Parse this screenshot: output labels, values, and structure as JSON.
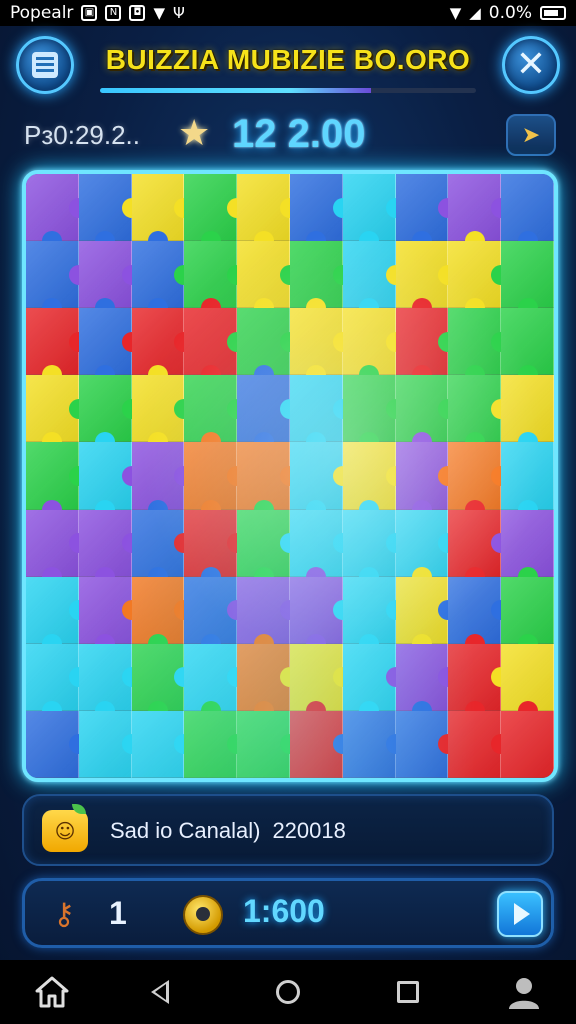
{
  "status_bar": {
    "carrier": "Popealr",
    "battery_text": "0.0%",
    "icons": [
      "image-icon",
      "n-icon",
      "bag-icon",
      "signal-icon",
      "usb-icon",
      "wifi-icon",
      "cell-signal-icon",
      "battery-icon"
    ]
  },
  "header": {
    "title": "BUIZZIA MUBIZIE BO.ORO",
    "progress": 0.72,
    "menu_icon": "menu-icon",
    "close_icon": "close-icon"
  },
  "score_row": {
    "label": "Pз0:29.2..",
    "value": "12 2.00",
    "star_icon": "star-icon",
    "hint_icon": "hint-icon"
  },
  "board": {
    "rows": 9,
    "cols": 10,
    "colors": {
      "R": "#e8262a",
      "B": "#2f6fe0",
      "G": "#2bd24a",
      "Y": "#f4e025",
      "C": "#29d4f2",
      "P": "#8c52e0",
      "O": "#f5761e",
      "L": "#7fb8ff"
    },
    "pieces": [
      [
        "P",
        "B",
        "Y",
        "G",
        "Y",
        "B",
        "C",
        "B",
        "P",
        "B"
      ],
      [
        "B",
        "P",
        "B",
        "G",
        "Y",
        "G",
        "C",
        "Y",
        "Y",
        "G"
      ],
      [
        "R",
        "B",
        "R",
        "R",
        "G",
        "Y",
        "Y",
        "R",
        "G",
        "G"
      ],
      [
        "Y",
        "G",
        "Y",
        "G",
        "B",
        "C",
        "G",
        "G",
        "G",
        "Y"
      ],
      [
        "G",
        "C",
        "P",
        "O",
        "O",
        "C",
        "Y",
        "P",
        "O",
        "C"
      ],
      [
        "P",
        "P",
        "B",
        "R",
        "G",
        "C",
        "C",
        "C",
        "R",
        "P"
      ],
      [
        "C",
        "P",
        "O",
        "B",
        "P",
        "P",
        "C",
        "Y",
        "B",
        "G"
      ],
      [
        "C",
        "C",
        "G",
        "C",
        "O",
        "Y",
        "C",
        "P",
        "R",
        "Y"
      ],
      [
        "B",
        "C",
        "C",
        "G",
        "G",
        "R",
        "B",
        "B",
        "R",
        "R"
      ]
    ]
  },
  "message": {
    "text": "Sad io Canalal)",
    "code": "220018",
    "icon": "mascot-icon"
  },
  "controls": {
    "keys": "1",
    "timer": "1:600",
    "key_icon": "key-icon",
    "timer_icon": "timer-icon",
    "play_icon": "play-icon"
  },
  "nav": [
    "home-icon",
    "back-icon",
    "home-circle-icon",
    "recents-icon",
    "profile-icon"
  ]
}
